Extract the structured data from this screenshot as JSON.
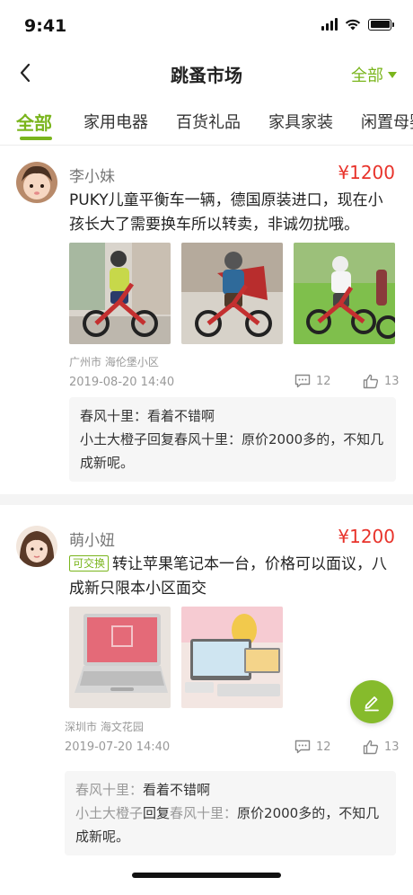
{
  "status_bar": {
    "time": "9:41"
  },
  "nav": {
    "title": "跳蚤市场",
    "filter_label": "全部"
  },
  "tabs": [
    {
      "label": "全部"
    },
    {
      "label": "家用电器"
    },
    {
      "label": "百货礼品"
    },
    {
      "label": "家具家装"
    },
    {
      "label": "闲置母婴"
    }
  ],
  "posts": [
    {
      "author": "李小妹",
      "price": "¥1200",
      "content": "PUKY儿童平衡车一辆，德国原装进口，现在小孩长大了需要换车所以转卖，非诚勿扰哦。",
      "location": "广州市 海伦堡小区",
      "date": "2019-08-20  14:40",
      "comment_count": "12",
      "like_count": "13",
      "comments": [
        {
          "name": "春风十里：",
          "text": "看着不错啊"
        },
        {
          "name": "小土大橙子回复春风十里：",
          "text": "原价2000多的，不知几成新呢。"
        }
      ]
    },
    {
      "author": "萌小妞",
      "price": "¥1200",
      "tag": "可交换",
      "content": "转让苹果笔记本一台，价格可以面议，八成新只限本小区面交",
      "location": "深圳市 海文花园",
      "date": "2019-07-20  14:40",
      "comment_count": "12",
      "like_count": "13",
      "comments": [
        {
          "name": "春风十里：",
          "text": "看着不错啊"
        },
        {
          "name_a": "小土大橙子",
          "reply": "回复",
          "name_b": "春风十里：",
          "text": "原价2000多的，不知几成新呢。"
        }
      ]
    }
  ],
  "colors": {
    "accent": "#7ab51d",
    "price": "#e8332b"
  }
}
